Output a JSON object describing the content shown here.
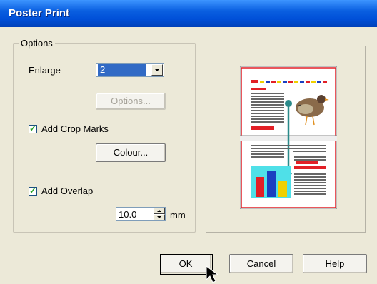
{
  "window": {
    "title": "Poster Print"
  },
  "options_group": {
    "label": "Options"
  },
  "enlarge": {
    "label": "Enlarge",
    "value": "2"
  },
  "options_button": {
    "label": "Options..."
  },
  "crop_marks": {
    "label": "Add Crop Marks",
    "checked": true
  },
  "colour_button": {
    "label": "Colour..."
  },
  "overlap": {
    "label": "Add Overlap",
    "checked": true,
    "value": "10.0",
    "unit": "mm"
  },
  "buttons": {
    "ok": "OK",
    "cancel": "Cancel",
    "help": "Help"
  },
  "colors": {
    "title_bar": "#0a5fe0",
    "selection": "#316ac5",
    "accent_red": "#e21f26",
    "accent_teal": "#2a8a8a"
  }
}
